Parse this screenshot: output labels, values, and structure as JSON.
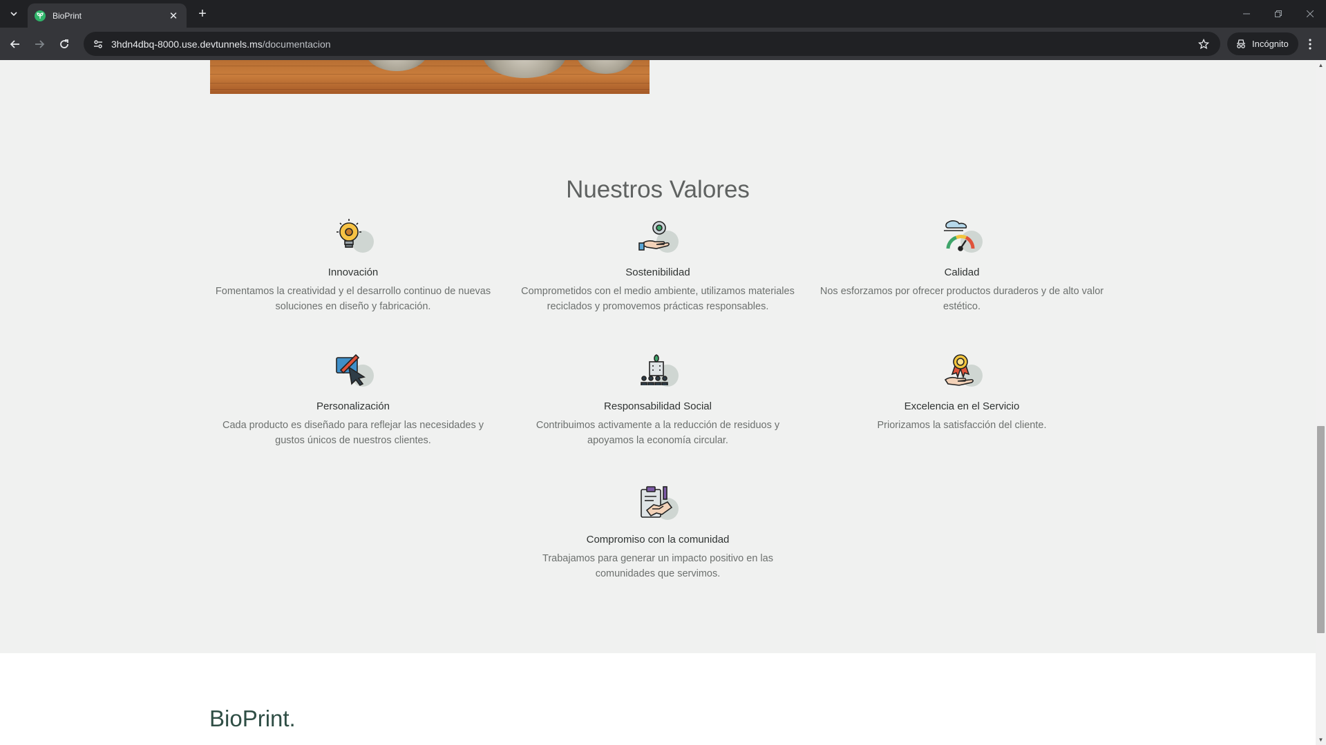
{
  "browser": {
    "tab_title": "BioPrint",
    "tab_close": "✕",
    "new_tab": "+",
    "url_host": "3hdn4dbq-8000.use.devtunnels.ms",
    "url_path": "/documentacion",
    "incognito_label": "Incógnito",
    "favicon_color": "#2fb56a"
  },
  "values": {
    "title": "Nuestros Valores",
    "items": [
      {
        "icon": "lightbulb-gear-icon",
        "title": "Innovación",
        "text": "Fomentamos la creatividad y el desarrollo continuo de nuevas soluciones en diseño y fabricación."
      },
      {
        "icon": "hand-gear-icon",
        "title": "Sostenibilidad",
        "text": "Comprometidos con el medio ambiente, utilizamos materiales reciclados y promovemos prácticas responsables."
      },
      {
        "icon": "gauge-icon",
        "title": "Calidad",
        "text": "Nos esforzamos por ofrecer productos duraderos y de alto valor estético."
      },
      {
        "icon": "design-cursor-icon",
        "title": "Personalización",
        "text": "Cada producto es diseñado para reflejar las necesidades y gustos únicos de nuestros clientes."
      },
      {
        "icon": "community-building-icon",
        "title": "Responsabilidad Social",
        "text": "Contribuimos activamente a la reducción de residuos y apoyamos la economía circular."
      },
      {
        "icon": "award-hand-icon",
        "title": "Excelencia en el Servicio",
        "text": "Priorizamos la satisfacción del cliente."
      },
      {
        "icon": "handshake-clipboard-icon",
        "title": "Compromiso con la comunidad",
        "text": "Trabajamos para generar un impacto positivo en las comunidades que servimos."
      }
    ]
  },
  "footer": {
    "brand": "BioPrint."
  },
  "colors": {
    "page_bg": "#f0f1f0",
    "heading": "#5f6261",
    "brand": "#2f4e45",
    "icon_accent": "#cfd6d2"
  }
}
